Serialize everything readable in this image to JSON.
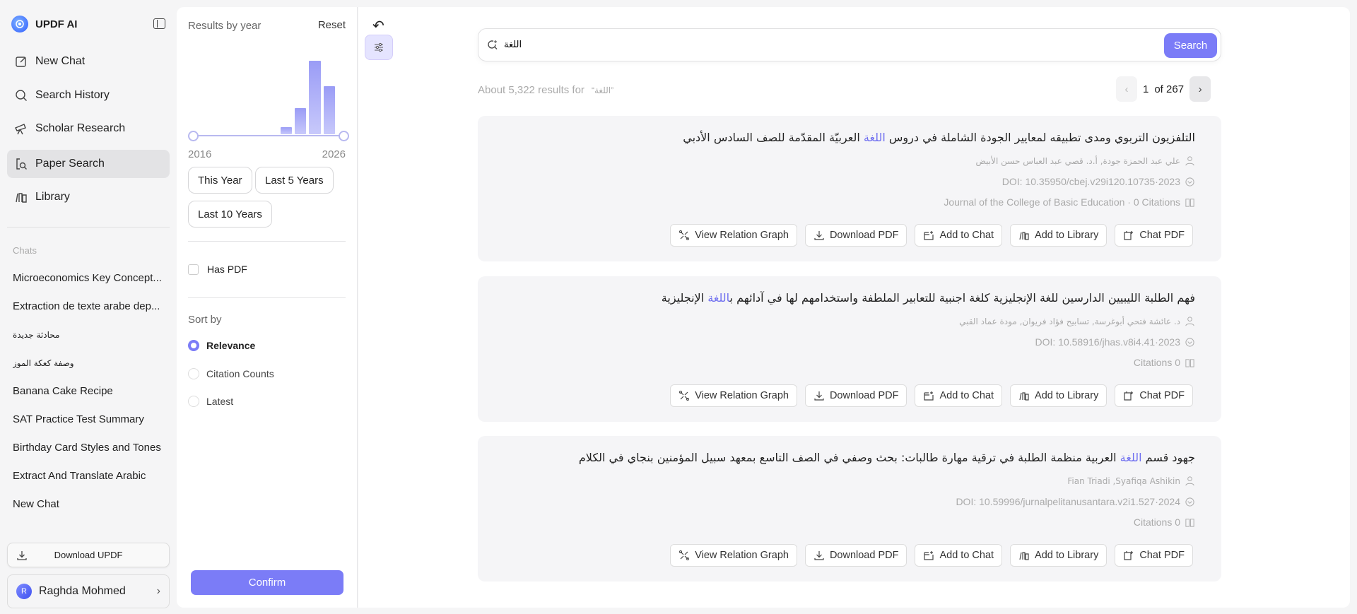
{
  "app": {
    "name": "UPDF AI"
  },
  "sidebar": {
    "nav": [
      {
        "label": "New Chat",
        "icon": "new-chat-icon"
      },
      {
        "label": "Search History",
        "icon": "search-icon"
      },
      {
        "label": "Scholar Research",
        "icon": "telescope-icon"
      },
      {
        "label": "Paper Search",
        "icon": "paper-search-icon",
        "active": true
      },
      {
        "label": "Library",
        "icon": "library-icon"
      }
    ],
    "chats_label": "Chats",
    "chats": [
      "Microeconomics Key Concept...",
      "Extraction de texte arabe dep...",
      "محادثة جديدة",
      "وصفة كعكة الموز",
      "Banana Cake Recipe",
      "SAT Practice Test Summary",
      "Birthday Card Styles and Tones",
      "Extract And Translate Arabic",
      "New Chat"
    ],
    "download_label": "Download UPDF",
    "user": {
      "initial": "R",
      "name": "Raghda Mohmed"
    }
  },
  "filters": {
    "title": "Results by year",
    "reset": "Reset",
    "histogram": {
      "years": [
        2016,
        2017,
        2018,
        2019,
        2020,
        2021,
        2022,
        2023,
        2024,
        2025,
        2026
      ],
      "relative_counts": [
        0,
        0,
        0,
        0,
        0,
        0,
        0,
        0.1,
        0.36,
        1.0,
        0.65
      ]
    },
    "range_start": "2016",
    "range_end": "2026",
    "quick": [
      "This Year",
      "Last 5 Years",
      "Last 10 Years"
    ],
    "has_pdf": "Has PDF",
    "sort_label": "Sort by",
    "sort_options": [
      "Relevance",
      "Citation Counts",
      "Latest"
    ],
    "sort_selected": "Relevance",
    "confirm": "Confirm"
  },
  "search": {
    "query": "اللغة",
    "button": "Search"
  },
  "results": {
    "summary": "About 5,322 results for",
    "query_quoted": "“اللغة”",
    "page": "1",
    "of_pages": "of 267"
  },
  "accent": "#7b7cf7",
  "actions": [
    "View Relation Graph",
    "Download PDF",
    "Add to Chat",
    "Add to Library",
    "Chat PDF"
  ],
  "papers": [
    {
      "title_pre": "التلفزيون التربوي ومدى تطبيقه لمعايير الجودة الشاملة في دروس ",
      "title_hl": "اللغة",
      "title_post": " العربيّة المقدّمة للصف السادس الأدبي",
      "authors": "علي عبد الحمزة جودة, أ.د. قصي عبد العباس حسن الأبيض",
      "doi": "DOI: 10.35950/cbej.v29i120.10735·2023",
      "venue": "Journal of the College of Basic Education · 0 Citations"
    },
    {
      "title_pre": "فهم الطلبة الليبيين الدارسين للغة الإنجليزية كلغة اجنبية للتعابير الملطفة واستخدامهم لها في آدائهم ب",
      "title_hl": "اللغة",
      "title_post": " الإنجليزية",
      "authors": "د. عائشة فتحي أبوغرسة, تسابيح فؤاد فريوان, مودة عماد القبي",
      "doi": "DOI: 10.58916/jhas.v8i4.41·2023",
      "venue": "Citations 0"
    },
    {
      "title_pre": "جهود قسم ",
      "title_hl": "اللغة",
      "title_post": " العربية منظمة الطلبة في ترقية مهارة طالبات: بحث وصفي في الصف التاسع بمعهد سبيل المؤمنين بنجاي في الكلام",
      "authors": "Fian Triadi ,Syafiqa Ashikin",
      "doi": "DOI: 10.59996/jurnalpelitanusantara.v2i1.527·2024",
      "venue": "Citations 0"
    }
  ]
}
